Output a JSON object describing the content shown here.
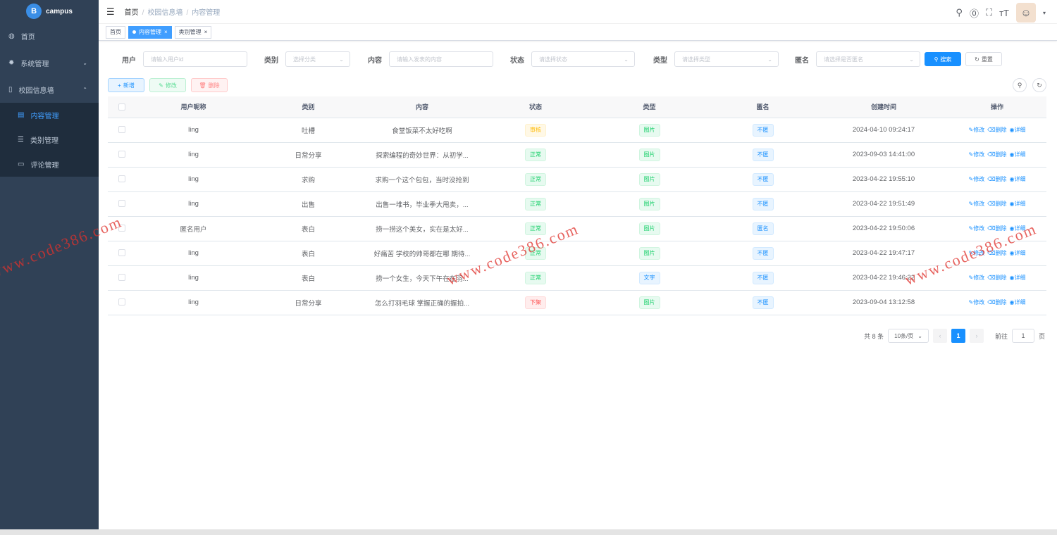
{
  "app": {
    "name": "campus"
  },
  "sidebar": {
    "items": [
      {
        "label": "首页",
        "icon": "dashboard-icon"
      },
      {
        "label": "系统管理",
        "icon": "gear-icon"
      },
      {
        "label": "校园信息墙",
        "icon": "book-icon"
      }
    ],
    "sub_items": [
      {
        "label": "内容管理",
        "icon": "document-icon",
        "active": true
      },
      {
        "label": "类别管理",
        "icon": "list-icon",
        "active": false
      },
      {
        "label": "评论管理",
        "icon": "comment-icon",
        "active": false
      }
    ]
  },
  "breadcrumb": [
    "首页",
    "校园信息墙",
    "内容管理"
  ],
  "tags": [
    {
      "label": "首页",
      "active": false
    },
    {
      "label": "内容管理",
      "active": true
    },
    {
      "label": "类别管理",
      "active": false
    }
  ],
  "search": {
    "user_label": "用户",
    "user_placeholder": "请输入用户id",
    "category_label": "类别",
    "category_placeholder": "选择分类",
    "content_label": "内容",
    "content_placeholder": "请输入发表的内容",
    "status_label": "状态",
    "status_placeholder": "请选择状态",
    "type_label": "类型",
    "type_placeholder": "请选择类型",
    "anon_label": "匿名",
    "anon_placeholder": "请选择是否匿名",
    "search_btn": "搜索",
    "reset_btn": "重置"
  },
  "toolbar": {
    "add": "新增",
    "edit": "修改",
    "delete": "删除"
  },
  "table": {
    "headers": [
      "用户昵称",
      "类别",
      "内容",
      "状态",
      "类型",
      "匿名",
      "创建时间",
      "操作"
    ],
    "rows": [
      {
        "user": "ling",
        "category": "吐槽",
        "content": "食堂饭菜不太好吃啊",
        "status": "审核",
        "status_kind": "warning",
        "type": "图片",
        "type_kind": "success",
        "anon": "不匿",
        "time": "2024-04-10 09:24:17"
      },
      {
        "user": "ling",
        "category": "日常分享",
        "content": "探索编程的奇妙世界：从初学...",
        "status": "正常",
        "status_kind": "success",
        "type": "图片",
        "type_kind": "success",
        "anon": "不匿",
        "time": "2023-09-03 14:41:00"
      },
      {
        "user": "ling",
        "category": "求购",
        "content": "求购一个这个包包，当时没抢到",
        "status": "正常",
        "status_kind": "success",
        "type": "图片",
        "type_kind": "success",
        "anon": "不匿",
        "time": "2023-04-22 19:55:10"
      },
      {
        "user": "ling",
        "category": "出售",
        "content": "出售一堆书，毕业季大甩卖，...",
        "status": "正常",
        "status_kind": "success",
        "type": "图片",
        "type_kind": "success",
        "anon": "不匿",
        "time": "2023-04-22 19:51:49"
      },
      {
        "user": "匿名用户",
        "category": "表白",
        "content": "捞一捞这个美女，实在是太好...",
        "status": "正常",
        "status_kind": "success",
        "type": "图片",
        "type_kind": "success",
        "anon": "匿名",
        "time": "2023-04-22 19:50:06"
      },
      {
        "user": "ling",
        "category": "表白",
        "content": "好痛苦 学校的帅哥都在哪 期待...",
        "status": "正常",
        "status_kind": "success",
        "type": "图片",
        "type_kind": "success",
        "anon": "不匿",
        "time": "2023-04-22 19:47:17"
      },
      {
        "user": "ling",
        "category": "表白",
        "content": "捞一个女生，今天下午在在羽...",
        "status": "正常",
        "status_kind": "success",
        "type": "文字",
        "type_kind": "info",
        "anon": "不匿",
        "time": "2023-04-22 19:46:22"
      },
      {
        "user": "ling",
        "category": "日常分享",
        "content": "怎么打羽毛球 掌握正确的握拍...",
        "status": "下架",
        "status_kind": "danger",
        "type": "图片",
        "type_kind": "success",
        "anon": "不匿",
        "time": "2023-09-04 13:12:58"
      }
    ],
    "actions": {
      "edit": "修改",
      "delete": "删除",
      "detail": "详细"
    }
  },
  "pagination": {
    "total": "共 8 条",
    "page_size": "10条/页",
    "current": "1",
    "goto_label": "前往",
    "goto_value": "1",
    "page_suffix": "页"
  },
  "watermark": "www.code386.com",
  "colors": {
    "primary": "#1890ff",
    "sidebar": "#304156",
    "success": "#13ce66",
    "warning": "#ffba00",
    "danger": "#ff4949"
  }
}
